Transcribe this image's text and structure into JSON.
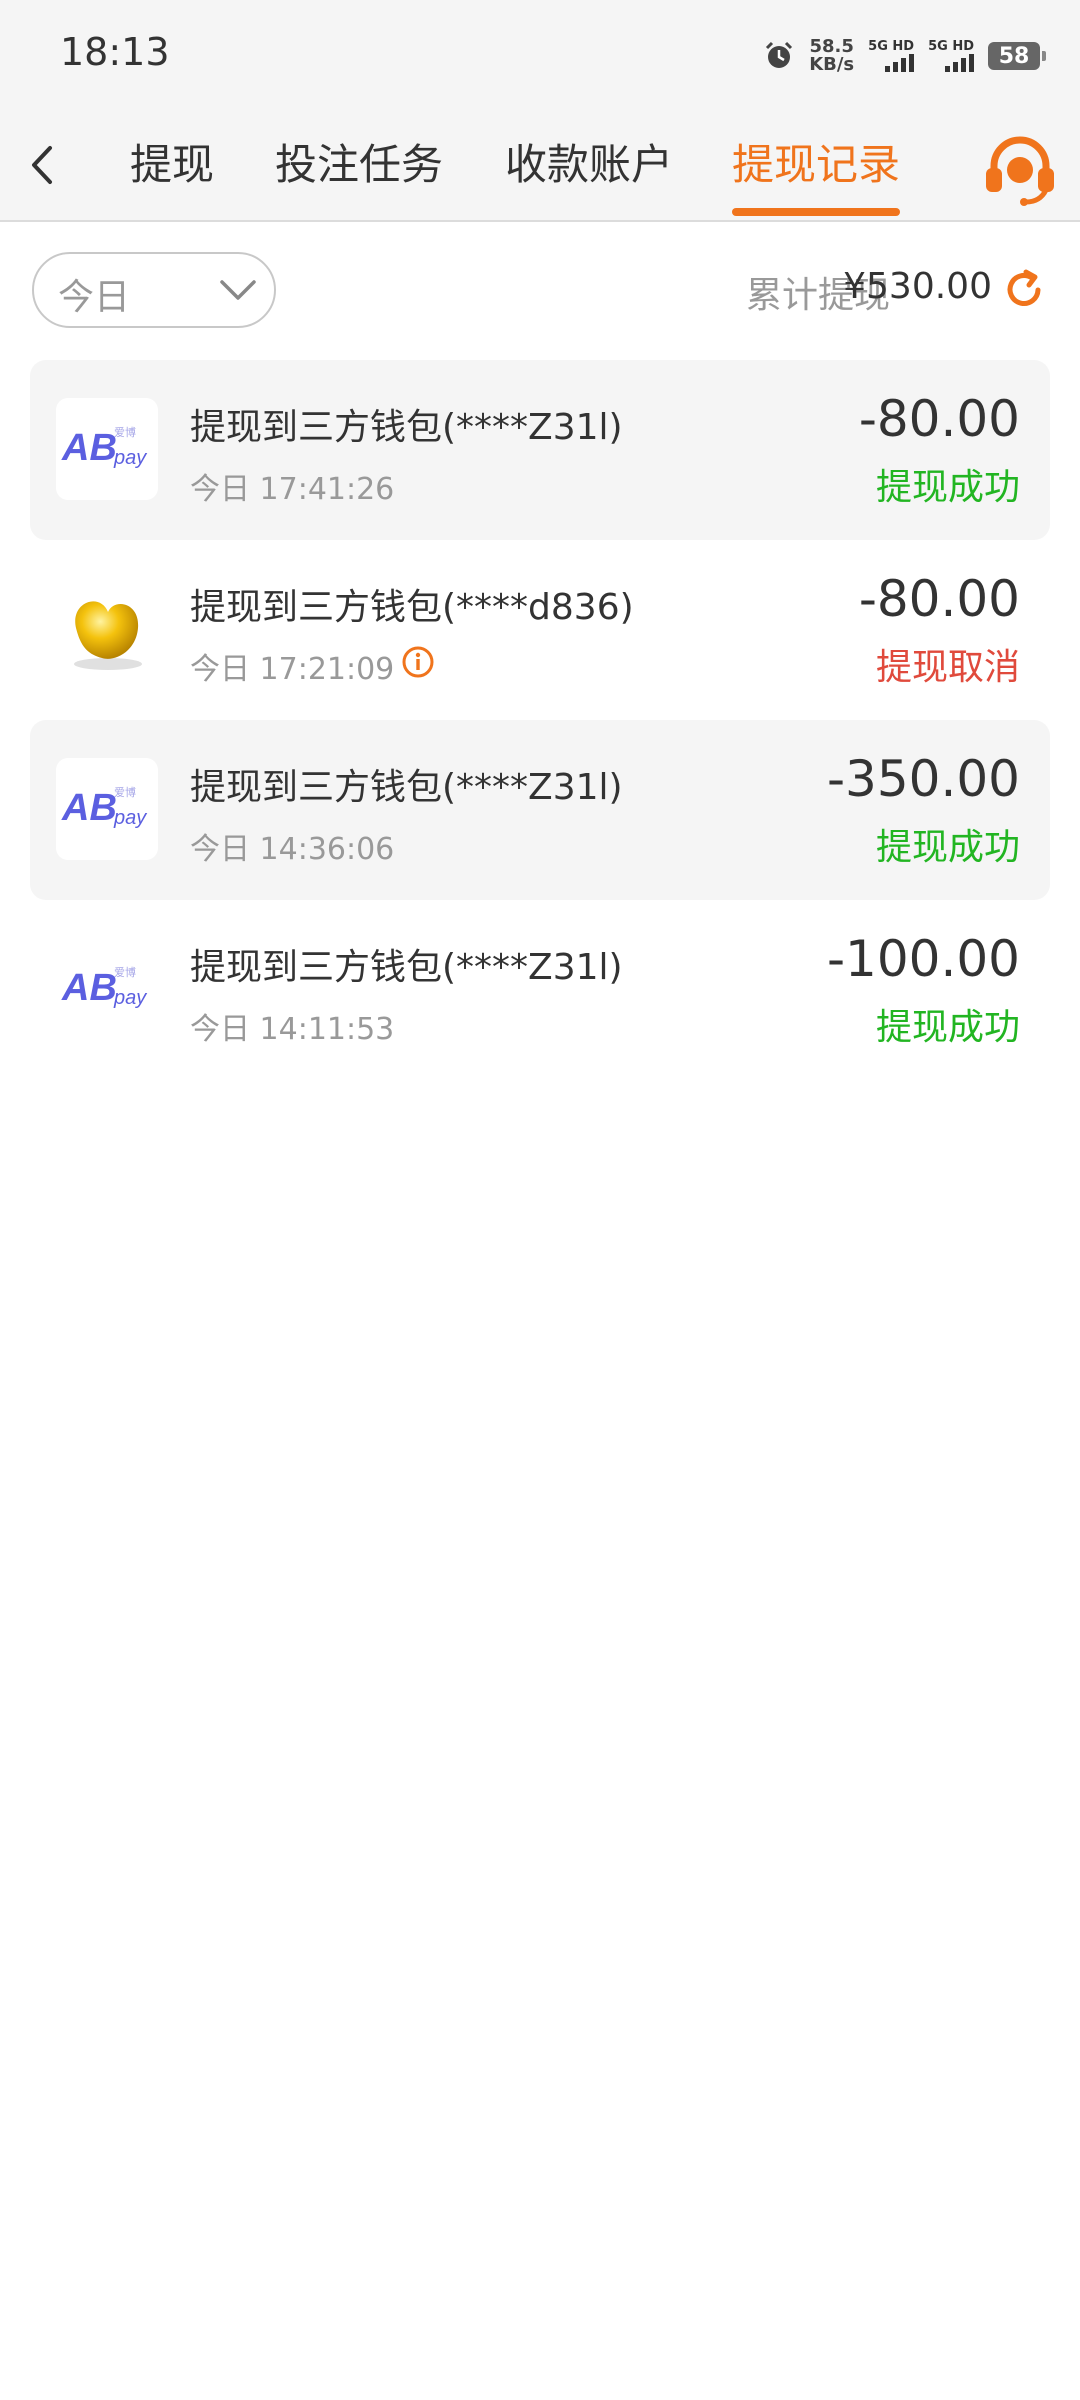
{
  "status_bar": {
    "time": "18:13",
    "speed_value": "58.5",
    "speed_unit": "KB/s",
    "sim1_label": "5G HD",
    "sim2_label": "5G HD",
    "battery": "58"
  },
  "nav": {
    "tabs": [
      {
        "label": "提现"
      },
      {
        "label": "投注任务"
      },
      {
        "label": "收款账户"
      },
      {
        "label": "提现记录"
      }
    ],
    "active_tab_index": 3,
    "icons": {
      "back": "chevron-left-icon",
      "support": "headset-icon"
    }
  },
  "filter": {
    "selected": "今日",
    "total_label": "累计提现",
    "total_value": "¥530.00"
  },
  "colors": {
    "accent": "#f0741c",
    "success": "#22b522",
    "cancel": "#e04a3c"
  },
  "records": [
    {
      "title": "提现到三方钱包(****Z31l)",
      "time": "今日 17:41:26",
      "amount": "-80.00",
      "status": "提现成功",
      "status_type": "success",
      "logo": "abpay"
    },
    {
      "title": "提现到三方钱包(****d836)",
      "time": "今日 17:21:09",
      "amount": "-80.00",
      "status": "提现取消",
      "status_type": "cancel",
      "logo": "gold-bean"
    },
    {
      "title": "提现到三方钱包(****Z31l)",
      "time": "今日 14:36:06",
      "amount": "-350.00",
      "status": "提现成功",
      "status_type": "success",
      "logo": "abpay"
    },
    {
      "title": "提现到三方钱包(****Z31l)",
      "time": "今日 14:11:53",
      "amount": "-100.00",
      "status": "提现成功",
      "status_type": "success",
      "logo": "abpay"
    }
  ],
  "abpay_logo": {
    "main": "AB",
    "sub": "pay",
    "cn": "爱博"
  }
}
